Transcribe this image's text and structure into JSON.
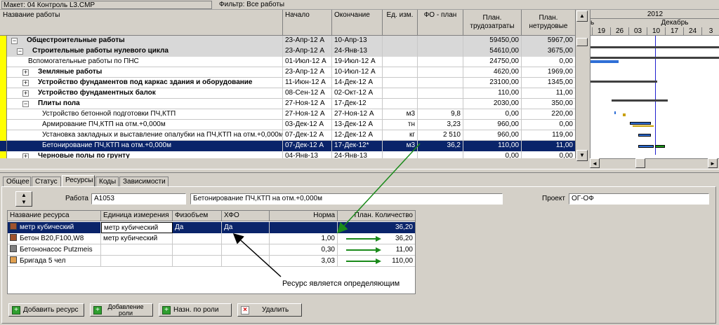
{
  "toolbar": {
    "layout": "Макет: 04 Контроль L3.CMP",
    "filter": "Фильтр: Все работы"
  },
  "grid": {
    "headers": [
      "Название работы",
      "Начало",
      "Окончание",
      "Ед. изм.",
      "ФО - план",
      "План. трудозатраты",
      "План. нетрудовые"
    ],
    "rows": [
      {
        "name": "Общестроительные работы",
        "start": "23-Апр-12 A",
        "end": "10-Апр-13",
        "unit": "",
        "fo": "",
        "labor": "59450,00",
        "nonlabor": "5967,00",
        "level": 0,
        "bold": true,
        "toggle": "−",
        "band": true
      },
      {
        "name": "Строительные работы нулевого цикла",
        "start": "23-Апр-12 A",
        "end": "24-Янв-13",
        "unit": "",
        "fo": "",
        "labor": "54610,00",
        "nonlabor": "3675,00",
        "level": 1,
        "bold": true,
        "toggle": "−",
        "band": true
      },
      {
        "name": "Вспомогательные работы по ПНС",
        "start": "01-Июл-12 A",
        "end": "19-Июл-12 A",
        "unit": "",
        "fo": "",
        "labor": "24750,00",
        "nonlabor": "0,00",
        "level": 2,
        "bold": false,
        "toggle": "",
        "band": false
      },
      {
        "name": "Земляные работы",
        "start": "23-Апр-12 A",
        "end": "10-Июл-12 A",
        "unit": "",
        "fo": "",
        "labor": "4620,00",
        "nonlabor": "1969,00",
        "level": 2,
        "bold": true,
        "toggle": "+",
        "band": false
      },
      {
        "name": "Устройство фундаментов под каркас здания и оборудование",
        "start": "11-Июн-12 A",
        "end": "14-Дек-12 A",
        "unit": "",
        "fo": "",
        "labor": "23100,00",
        "nonlabor": "1345,00",
        "level": 2,
        "bold": true,
        "toggle": "+",
        "band": false
      },
      {
        "name": "Устройство фундаментных балок",
        "start": "08-Сен-12 A",
        "end": "02-Окт-12 A",
        "unit": "",
        "fo": "",
        "labor": "110,00",
        "nonlabor": "11,00",
        "level": 2,
        "bold": true,
        "toggle": "+",
        "band": false
      },
      {
        "name": "Плиты пола",
        "start": "27-Ноя-12 A",
        "end": "17-Дек-12",
        "unit": "",
        "fo": "",
        "labor": "2030,00",
        "nonlabor": "350,00",
        "level": 2,
        "bold": true,
        "toggle": "−",
        "band": false
      },
      {
        "name": "Устройство бетонной подготовки ПЧ,КТП",
        "start": "27-Ноя-12 A",
        "end": "27-Ноя-12 A",
        "unit": "м3",
        "fo": "9,8",
        "labor": "0,00",
        "nonlabor": "220,00",
        "level": 3,
        "bold": false,
        "toggle": "",
        "band": false
      },
      {
        "name": "Армирование ПЧ,КТП  на отм.+0,000м",
        "start": "03-Дек-12 A",
        "end": "13-Дек-12 A",
        "unit": "тн",
        "fo": "3,23",
        "labor": "960,00",
        "nonlabor": "0,00",
        "level": 3,
        "bold": false,
        "toggle": "",
        "band": false
      },
      {
        "name": "Установка закладных и выставление опалубки на  ПЧ,КТП на отм.+0,000м",
        "start": "07-Дек-12 A",
        "end": "12-Дек-12 A",
        "unit": "кг",
        "fo": "2 510",
        "labor": "960,00",
        "nonlabor": "119,00",
        "level": 3,
        "bold": false,
        "toggle": "",
        "band": false
      },
      {
        "name": "Бетонирование ПЧ,КТП на отм.+0,000м",
        "start": "07-Дек-12 A",
        "end": "17-Дек-12*",
        "unit": "м3",
        "fo": "36,2",
        "labor": "110,00",
        "nonlabor": "11,00",
        "level": 3,
        "bold": false,
        "toggle": "",
        "band": false,
        "selected": true
      },
      {
        "name": "Черновые полы по грунту",
        "start": "04-Янв-13",
        "end": "24-Янв-13",
        "unit": "",
        "fo": "",
        "labor": "0,00",
        "nonlabor": "0,00",
        "level": 2,
        "bold": true,
        "toggle": "+",
        "band": false
      }
    ]
  },
  "gantt": {
    "year": "2012",
    "month_prev": "ь",
    "month": "Декабрь",
    "days": [
      "19",
      "26",
      "03",
      "10",
      "17",
      "24",
      "3"
    ]
  },
  "tabs": [
    "Общее",
    "Статус",
    "Ресурсы",
    "Коды",
    "Зависимости"
  ],
  "active_tab": "Ресурсы",
  "details": {
    "work_label": "Работа",
    "work_id": "A1053",
    "work_name": "Бетонирование ПЧ,КТП на отм.+0,000м",
    "project_label": "Проект",
    "project_value": "ОГ-ОФ"
  },
  "resources": {
    "headers": [
      "Название ресурса",
      "Единица измерения",
      "Физобъем",
      "ХФО",
      "Норма",
      "План. Количество"
    ],
    "rows": [
      {
        "icon": "material-icon",
        "name": "метр кубический",
        "unit": "метр кубический",
        "phys": "Да",
        "hfo": "Да",
        "norm": "",
        "qty": "36,20",
        "selected": true,
        "arrow": false
      },
      {
        "icon": "material-icon",
        "name": "Бетон В20,F100,W8",
        "unit": "метр кубический",
        "phys": "",
        "hfo": "",
        "norm": "1,00",
        "qty": "36,20",
        "selected": false,
        "arrow": true
      },
      {
        "icon": "equipment-icon",
        "name": "Бетононасос Putzmeis",
        "unit": "",
        "phys": "",
        "hfo": "",
        "norm": "0,30",
        "qty": "11,00",
        "selected": false,
        "arrow": true
      },
      {
        "icon": "labor-icon",
        "name": "Бригада 5 чел",
        "unit": "",
        "phys": "",
        "hfo": "",
        "norm": "3,03",
        "qty": "110,00",
        "selected": false,
        "arrow": true
      }
    ]
  },
  "annotation": "Ресурс является определяющим",
  "buttons": [
    "Добавить ресурс",
    "Добавление роли",
    "Назн. по роли",
    "Удалить"
  ],
  "colors": {
    "selection": "#0a246a",
    "arrow": "#1a8a1a",
    "gantt_bar": "#2f6fd6",
    "today_line": "#2020d0"
  }
}
